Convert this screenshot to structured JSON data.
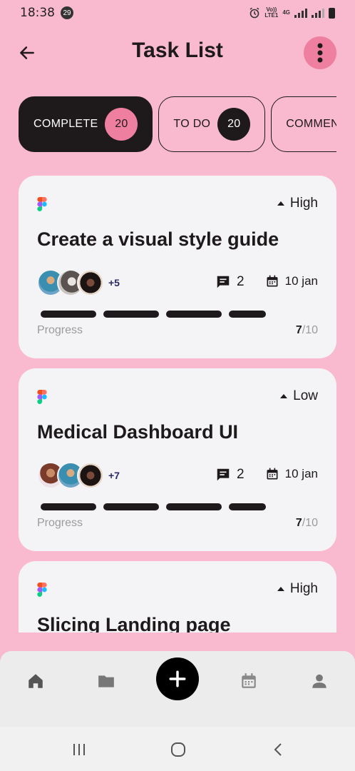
{
  "status_bar": {
    "time": "18:38",
    "notification_count": "29",
    "network": {
      "line1": "Vo))",
      "line2": "LTE1",
      "line3": "4G"
    }
  },
  "header": {
    "title": "Task List",
    "back_icon": "arrow-left-icon",
    "more_icon": "more-vertical-icon"
  },
  "tabs": [
    {
      "label": "COMPLETE",
      "count": "20",
      "active": true
    },
    {
      "label": "TO DO",
      "count": "20",
      "active": false
    },
    {
      "label": "COMMENTS",
      "count": "",
      "active": false
    }
  ],
  "tasks": [
    {
      "title": "Create a visual style guide",
      "priority": "High",
      "extra_avatars": "+5",
      "comments": "2",
      "due": "10 jan",
      "progress_label": "Progress",
      "progress_done": "7",
      "progress_total": "/10"
    },
    {
      "title": "Medical Dashboard UI",
      "priority": "Low",
      "extra_avatars": "+7",
      "comments": "2",
      "due": "10 jan",
      "progress_label": "Progress",
      "progress_done": "7",
      "progress_total": "/10"
    },
    {
      "title": "Slicing Landing page",
      "priority": "High"
    }
  ],
  "bottom_nav": {
    "items": [
      "home-icon",
      "folder-icon",
      "add-icon",
      "calendar-icon",
      "profile-icon"
    ]
  },
  "colors": {
    "background": "#f9b9cf",
    "accent": "#ef7fa0",
    "dark": "#1e1a1c",
    "card": "#f4f3f5"
  }
}
